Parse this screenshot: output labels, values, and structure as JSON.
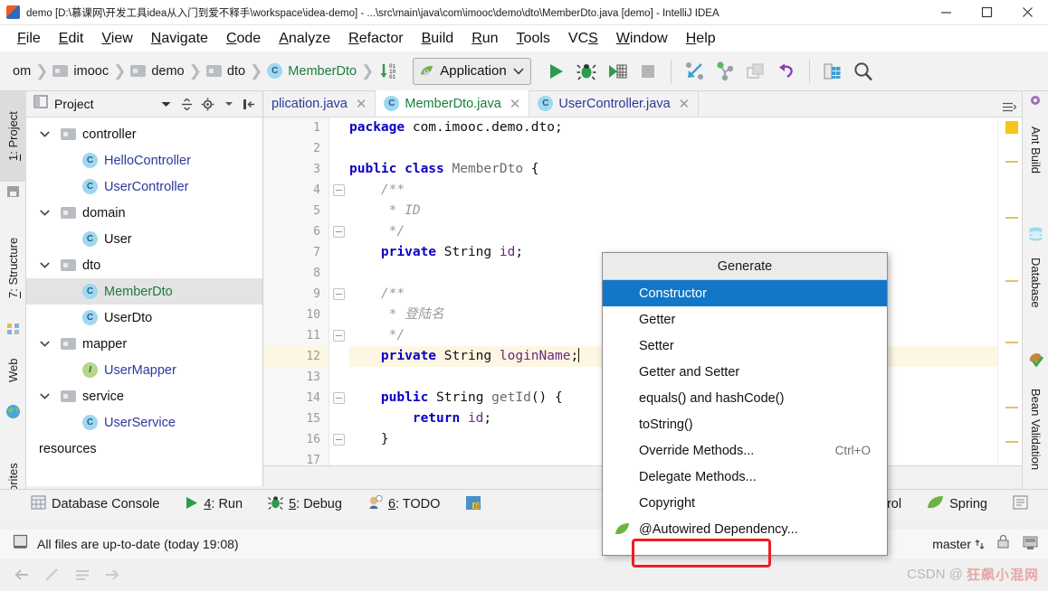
{
  "window": {
    "title": "demo [D:\\慕课网\\开发工具idea从入门到爱不释手\\workspace\\idea-demo] - ...\\src\\main\\java\\com\\imooc\\demo\\dto\\MemberDto.java [demo] - IntelliJ IDEA",
    "app_icon": "intellij-idea-icon",
    "minimize": "minimize-button",
    "maximize": "maximize-button",
    "close": "close-button"
  },
  "menubar": {
    "items": [
      {
        "label": "File",
        "mnemonic": "F"
      },
      {
        "label": "Edit",
        "mnemonic": "E"
      },
      {
        "label": "View",
        "mnemonic": "V"
      },
      {
        "label": "Navigate",
        "mnemonic": "N"
      },
      {
        "label": "Code",
        "mnemonic": "C"
      },
      {
        "label": "Analyze",
        "mnemonic": "A"
      },
      {
        "label": "Refactor",
        "mnemonic": "R"
      },
      {
        "label": "Build",
        "mnemonic": "B"
      },
      {
        "label": "Run",
        "mnemonic": "R"
      },
      {
        "label": "Tools",
        "mnemonic": "T"
      },
      {
        "label": "VCS",
        "mnemonic": "S"
      },
      {
        "label": "Window",
        "mnemonic": "W"
      },
      {
        "label": "Help",
        "mnemonic": "H"
      }
    ]
  },
  "toolbar": {
    "breadcrumbs": [
      {
        "label": "om",
        "icon": "truncated-text"
      },
      {
        "label": "imooc",
        "icon": "folder-icon"
      },
      {
        "label": "demo",
        "icon": "folder-icon"
      },
      {
        "label": "dto",
        "icon": "folder-icon"
      },
      {
        "label": "MemberDto",
        "icon": "class-icon",
        "color": "green"
      }
    ],
    "run_config": "Application",
    "buttons": [
      "compare-with-icon",
      "run-button",
      "debug-button",
      "run-coverage-button",
      "stop-button",
      "jump-to-source-icon",
      "vcs-update-icon",
      "vcs-commit-icon",
      "undo-icon",
      "database-icon",
      "search-everywhere-icon"
    ]
  },
  "left_tool_strip": {
    "tabs": [
      {
        "label": "1: Project",
        "mnemonic": "1",
        "active": true
      },
      {
        "label": "7: Structure",
        "mnemonic": "7",
        "active": false
      },
      {
        "label": "Web",
        "active": false
      },
      {
        "label": "orites",
        "active": false
      }
    ]
  },
  "right_tool_strip": {
    "tabs": [
      {
        "label": "Ant Build",
        "icon": "ant-icon"
      },
      {
        "label": "Database",
        "icon": "database-icon"
      },
      {
        "label": "Bean Validation",
        "icon": "bean-validation-icon"
      }
    ]
  },
  "project_panel": {
    "title": "Project",
    "header_buttons": [
      "chevron-down-icon",
      "collapse-all-icon",
      "gear-icon",
      "hide-icon"
    ],
    "tree": [
      {
        "label": "controller",
        "type": "folder",
        "indent": 0,
        "expanded": true,
        "selected": false
      },
      {
        "label": "HelloController",
        "type": "class",
        "indent": 1,
        "selected": false
      },
      {
        "label": "UserController",
        "type": "class",
        "indent": 1,
        "selected": false
      },
      {
        "label": "domain",
        "type": "folder",
        "indent": 0,
        "expanded": true,
        "selected": false
      },
      {
        "label": "User",
        "type": "class",
        "indent": 1,
        "selected": false
      },
      {
        "label": "dto",
        "type": "folder",
        "indent": 0,
        "expanded": true,
        "selected": false
      },
      {
        "label": "MemberDto",
        "type": "class-green",
        "indent": 1,
        "selected": true
      },
      {
        "label": "UserDto",
        "type": "class",
        "indent": 1,
        "selected": false
      },
      {
        "label": "mapper",
        "type": "folder",
        "indent": 0,
        "expanded": true,
        "selected": false
      },
      {
        "label": "UserMapper",
        "type": "interface",
        "indent": 1,
        "selected": false
      },
      {
        "label": "service",
        "type": "folder",
        "indent": 0,
        "expanded": true,
        "selected": false
      },
      {
        "label": "UserService",
        "type": "class",
        "indent": 1,
        "selected": false
      },
      {
        "label": "resources",
        "type": "plain",
        "indent": 0,
        "selected": false
      }
    ]
  },
  "editor": {
    "tabs": [
      {
        "label": "plication.java",
        "icon": "class-icon",
        "color": "blue",
        "active": false,
        "truncated": true
      },
      {
        "label": "MemberDto.java",
        "icon": "class-icon",
        "color": "green",
        "active": true
      },
      {
        "label": "UserController.java",
        "icon": "class-icon",
        "color": "blue",
        "active": false
      }
    ],
    "breadcrumb": "MemberDto",
    "current_line": 12,
    "lines": [
      {
        "n": 1,
        "text": "package com.imooc.demo.dto;"
      },
      {
        "n": 2,
        "text": ""
      },
      {
        "n": 3,
        "text": "public class MemberDto {"
      },
      {
        "n": 4,
        "text": "    /**"
      },
      {
        "n": 5,
        "text": "     * ID"
      },
      {
        "n": 6,
        "text": "     */"
      },
      {
        "n": 7,
        "text": "    private String id;"
      },
      {
        "n": 8,
        "text": ""
      },
      {
        "n": 9,
        "text": "    /**"
      },
      {
        "n": 10,
        "text": "     * 登陆名"
      },
      {
        "n": 11,
        "text": "     */"
      },
      {
        "n": 12,
        "text": "    private String loginName;"
      },
      {
        "n": 13,
        "text": ""
      },
      {
        "n": 14,
        "text": "    public String getId() {"
      },
      {
        "n": 15,
        "text": "        return id;"
      },
      {
        "n": 16,
        "text": "    }"
      },
      {
        "n": 17,
        "text": ""
      }
    ]
  },
  "generate_popup": {
    "title": "Generate",
    "items": [
      {
        "label": "Constructor",
        "selected": true,
        "shortcut": "",
        "icon": ""
      },
      {
        "label": "Getter",
        "selected": false,
        "shortcut": "",
        "icon": ""
      },
      {
        "label": "Setter",
        "selected": false,
        "shortcut": "",
        "icon": ""
      },
      {
        "label": "Getter and Setter",
        "selected": false,
        "shortcut": "",
        "icon": ""
      },
      {
        "label": "equals() and hashCode()",
        "selected": false,
        "shortcut": "",
        "icon": ""
      },
      {
        "label": "toString()",
        "selected": false,
        "shortcut": "",
        "icon": ""
      },
      {
        "label": "Override Methods...",
        "selected": false,
        "shortcut": "Ctrl+O",
        "icon": ""
      },
      {
        "label": "Delegate Methods...",
        "selected": false,
        "shortcut": "",
        "icon": ""
      },
      {
        "label": "Copyright",
        "selected": false,
        "shortcut": "",
        "icon": ""
      },
      {
        "label": "@Autowired Dependency...",
        "selected": false,
        "shortcut": "",
        "icon": "spring-leaf-icon"
      }
    ],
    "highlight_color": "#ee1c25",
    "selection_color": "#1277c9"
  },
  "bottom_bar": {
    "items": [
      {
        "label": "Database Console",
        "icon": "database-console-icon",
        "mnemonic": ""
      },
      {
        "label": "4: Run",
        "icon": "run-icon",
        "mnemonic": "4"
      },
      {
        "label": "5: Debug",
        "icon": "debug-icon",
        "mnemonic": "5"
      },
      {
        "label": "6: TODO",
        "icon": "todo-icon",
        "mnemonic": "6"
      },
      {
        "label": "",
        "icon": "terminal-icon",
        "mnemonic": ""
      },
      {
        "label": "trol",
        "icon": "",
        "mnemonic": ""
      },
      {
        "label": "Spring",
        "icon": "spring-leaf-icon",
        "mnemonic": ""
      },
      {
        "label": "",
        "icon": "event-log-icon",
        "mnemonic": ""
      }
    ]
  },
  "status_bar": {
    "message": "All files are up-to-date (today 19:08)",
    "icon": "save-indicator-icon",
    "branch": "master",
    "right_icons": [
      "lock-icon",
      "gear-icon"
    ]
  },
  "footer": {
    "icons": [
      "back-arrow-icon",
      "edit-pencil-icon",
      "list-icon",
      "forward-arrow-icon"
    ]
  },
  "watermark": {
    "prefix": "CSDN @",
    "name": "狂飙小混网"
  }
}
